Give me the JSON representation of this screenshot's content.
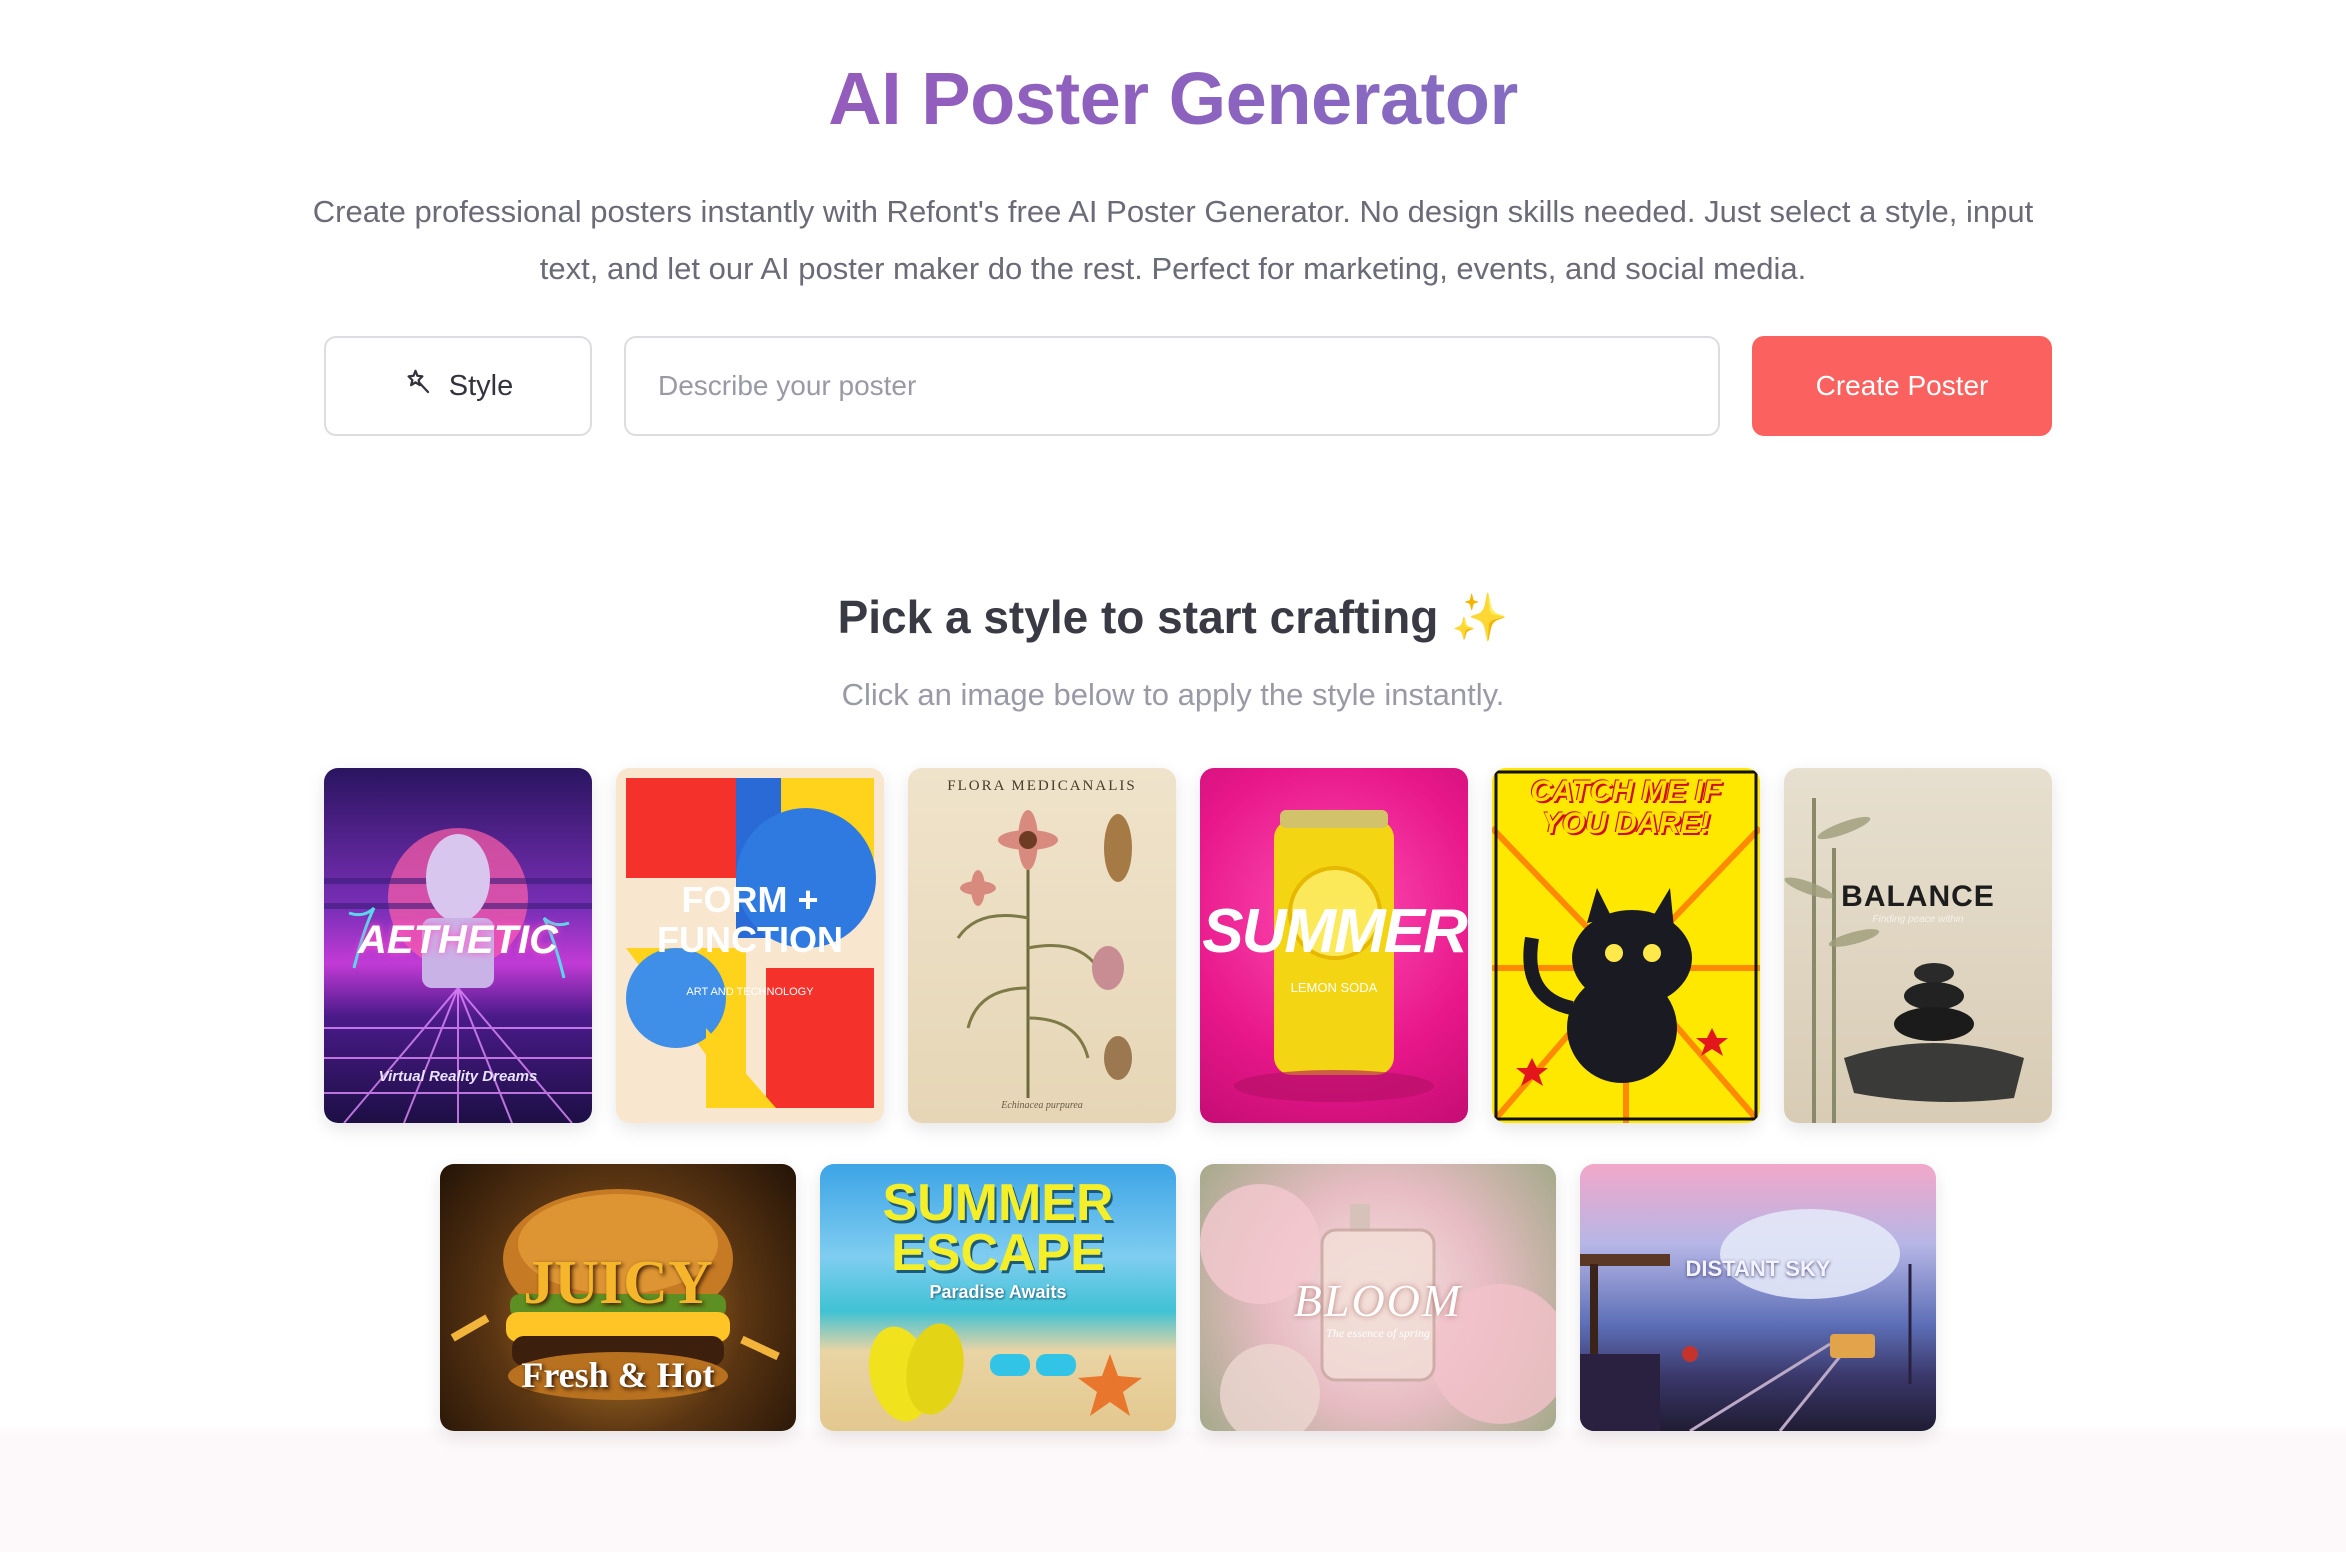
{
  "hero": {
    "title": "AI Poster Generator",
    "description": "Create professional posters instantly with Refont's free AI Poster Generator. No design skills needed. Just select a style, input text, and let our AI poster maker do the rest. Perfect for marketing, events, and social media."
  },
  "controls": {
    "style_label": "Style",
    "style_icon": "magic-wand-icon",
    "prompt_placeholder": "Describe your poster",
    "prompt_value": "",
    "create_label": "Create Poster"
  },
  "gallery": {
    "title": "Pick a style to start crafting ✨",
    "subtitle": "Click an image below to apply the style instantly.",
    "cards": [
      {
        "id": "aesthetic",
        "headline": "AETHETIC",
        "sub": "Virtual Reality Dreams"
      },
      {
        "id": "form-function",
        "headline": "FORM + FUNCTION",
        "sub": "ART AND TECHNOLOGY"
      },
      {
        "id": "flora",
        "headline": "FLORA MEDICANALIS",
        "sub": "Echinacea purpurea"
      },
      {
        "id": "summer-soda",
        "headline": "SUMMER",
        "sub": "LEMON SODA"
      },
      {
        "id": "catch-me",
        "headline": "CATCH ME IF YOU DARE!",
        "sub": ""
      },
      {
        "id": "balance",
        "headline": "BALANCE",
        "sub": "Finding peace within"
      },
      {
        "id": "juicy",
        "headline": "JUICY",
        "sub": "Fresh & Hot"
      },
      {
        "id": "summer-escape",
        "headline": "SUMMER ESCAPE",
        "sub": "Paradise Awaits"
      },
      {
        "id": "bloom",
        "headline": "BLOOM",
        "sub": "The essence of spring"
      },
      {
        "id": "distant-sky",
        "headline": "DISTANT SKY",
        "sub": ""
      }
    ]
  },
  "colors": {
    "accent": "#fb615f",
    "title_gradient_start": "#a44fb6",
    "title_gradient_end": "#6f86c6"
  }
}
